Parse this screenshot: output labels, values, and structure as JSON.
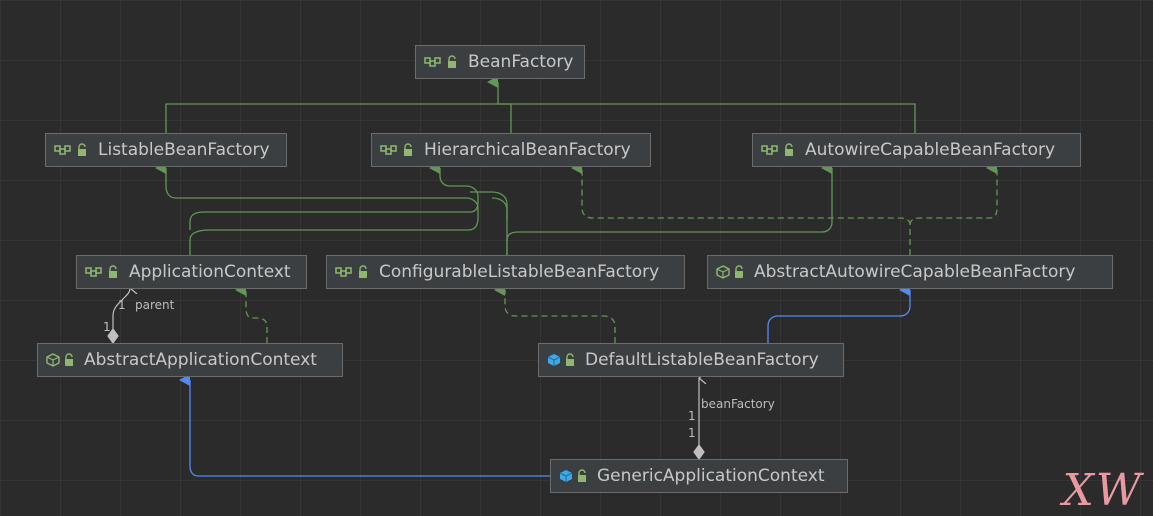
{
  "nodes": {
    "bean_factory": {
      "label": "BeanFactory",
      "kind": "interface"
    },
    "listable_bean_factory": {
      "label": "ListableBeanFactory",
      "kind": "interface"
    },
    "hierarchical_bean_factory": {
      "label": "HierarchicalBeanFactory",
      "kind": "interface"
    },
    "autowire_capable_bean_factory": {
      "label": "AutowireCapableBeanFactory",
      "kind": "interface"
    },
    "application_context": {
      "label": "ApplicationContext",
      "kind": "interface"
    },
    "configurable_listable_bean_factory": {
      "label": "ConfigurableListableBeanFactory",
      "kind": "interface"
    },
    "abstract_autowire_capable_bean_factory": {
      "label": "AbstractAutowireCapableBeanFactory",
      "kind": "abstract-class"
    },
    "abstract_application_context": {
      "label": "AbstractApplicationContext",
      "kind": "abstract-class"
    },
    "default_listable_bean_factory": {
      "label": "DefaultListableBeanFactory",
      "kind": "class"
    },
    "generic_application_context": {
      "label": "GenericApplicationContext",
      "kind": "class"
    }
  },
  "edge_labels": {
    "parent_role": "parent",
    "parent_mult_top": "1",
    "parent_mult_bottom": "1",
    "bean_factory_role": "beanFactory",
    "bean_factory_mult_top": "1",
    "bean_factory_mult_bottom": "1"
  },
  "colors": {
    "interface_edge": "#629755",
    "class_edge": "#548af7",
    "association_edge": "#bfbfbf",
    "node_bg": "#3c3f41",
    "node_border": "#6b6b6b",
    "text": "#c8c8c8",
    "watermark": "#e89aa0"
  },
  "icons": {
    "interface": "interface-icon",
    "abstract-class": "abstract-class-icon",
    "class": "class-icon",
    "visibility": "public-lock-icon"
  },
  "watermark": "XW"
}
